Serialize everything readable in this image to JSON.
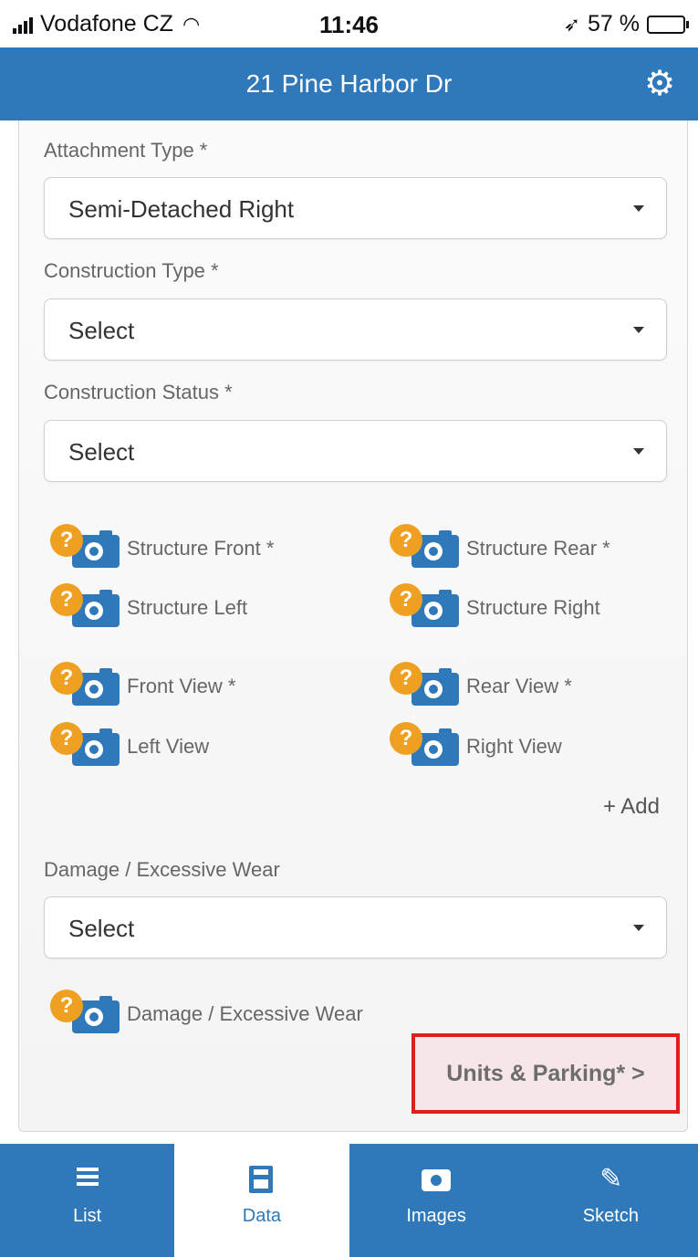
{
  "status_bar": {
    "carrier": "Vodafone CZ",
    "time": "11:46",
    "battery": "57 %",
    "battery_level": 0.57
  },
  "header": {
    "title": "21 Pine Harbor Dr",
    "settings_icon": "gear-icon"
  },
  "form": {
    "attachment_type": {
      "label": "Attachment Type *",
      "value": "Semi-Detached Right"
    },
    "construction_type": {
      "label": "Construction Type *",
      "value": "Select"
    },
    "construction_status": {
      "label": "Construction Status *",
      "value": "Select"
    },
    "damage": {
      "label": "Damage / Excessive Wear",
      "value": "Select"
    }
  },
  "photos": [
    {
      "label": "Structure Front *"
    },
    {
      "label": "Structure Rear *"
    },
    {
      "label": "Structure Left"
    },
    {
      "label": "Structure Right"
    },
    {
      "label": "Front View *"
    },
    {
      "label": "Rear View *"
    },
    {
      "label": "Left View"
    },
    {
      "label": "Right View"
    },
    {
      "label": "Damage / Excessive Wear"
    }
  ],
  "add_link": "+ Add",
  "next_button": "Units & Parking* >",
  "bottom_nav": [
    {
      "label": "List",
      "icon": "list-icon",
      "active": false
    },
    {
      "label": "Data",
      "icon": "save-icon",
      "active": true
    },
    {
      "label": "Images",
      "icon": "camera-icon",
      "active": false
    },
    {
      "label": "Sketch",
      "icon": "pencil-icon",
      "active": false
    }
  ],
  "colors": {
    "primary": "#2f78ba",
    "badge": "#f0a020",
    "highlight_border": "#e21d1d"
  }
}
